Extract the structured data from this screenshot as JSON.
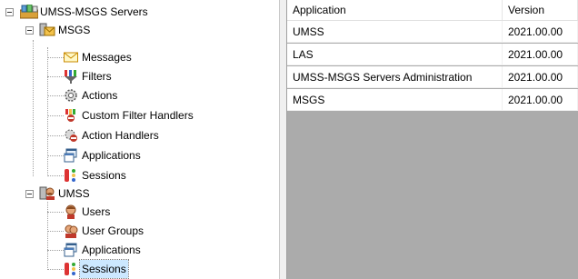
{
  "tree": {
    "root": {
      "label": "UMSS-MSGS Servers",
      "icon": "servers-root-icon"
    },
    "groups": [
      {
        "label": "MSGS",
        "icon": "msgs-server-icon",
        "items": [
          {
            "label": "Messages",
            "icon": "envelope-icon"
          },
          {
            "label": "Filters",
            "icon": "filter-icon"
          },
          {
            "label": "Actions",
            "icon": "gear-icon"
          },
          {
            "label": "Custom Filter Handlers",
            "icon": "custom-filter-handler-icon"
          },
          {
            "label": "Action Handlers",
            "icon": "action-handler-icon"
          },
          {
            "label": "Applications",
            "icon": "applications-icon"
          },
          {
            "label": "Sessions",
            "icon": "sessions-icon"
          }
        ]
      },
      {
        "label": "UMSS",
        "icon": "umss-server-icon",
        "items": [
          {
            "label": "Users",
            "icon": "user-icon"
          },
          {
            "label": "User Groups",
            "icon": "user-group-icon"
          },
          {
            "label": "Applications",
            "icon": "applications-icon"
          },
          {
            "label": "Sessions",
            "icon": "sessions-icon"
          }
        ]
      }
    ]
  },
  "list": {
    "columns": [
      "Application",
      "Version"
    ],
    "rows": [
      [
        "UMSS",
        "2021.00.00"
      ],
      [
        "LAS",
        "2021.00.00"
      ],
      [
        "UMSS-MSGS Servers Administration",
        "2021.00.00"
      ],
      [
        "MSGS",
        "2021.00.00"
      ]
    ]
  },
  "colors": {
    "list_background": "#ababab",
    "selection": "#cce8ff"
  }
}
